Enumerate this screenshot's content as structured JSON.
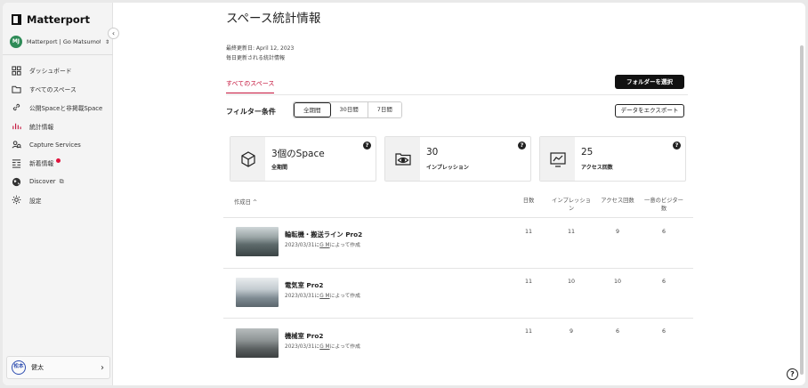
{
  "brand": {
    "name": "Matterport"
  },
  "org": {
    "initials": "MJ",
    "name": "Matterport | Go Matsumoto"
  },
  "sidebar": {
    "items": [
      {
        "label": "ダッシュボード",
        "icon": "dashboard-icon"
      },
      {
        "label": "すべてのスペース",
        "icon": "folder-icon"
      },
      {
        "label": "公開Spaceと非掲載Space",
        "icon": "link-icon"
      },
      {
        "label": "統計情報",
        "icon": "stats-icon",
        "active": true
      },
      {
        "label": "Capture Services",
        "icon": "capture-services-icon"
      },
      {
        "label": "新着情報",
        "icon": "news-icon",
        "badge": "red-dot"
      },
      {
        "label": "Discover",
        "icon": "globe-icon",
        "external": true
      },
      {
        "label": "設定",
        "icon": "gear-icon"
      }
    ]
  },
  "user": {
    "initials": "松本",
    "name": "健太"
  },
  "page": {
    "title": "スペース統計情報",
    "last_updated": "最終更新日: April 12, 2023",
    "update_note": "毎日更新される統計情報",
    "tab_all": "すべてのスペース",
    "select_folder": "フォルダーを選択",
    "filter_label": "フィルター条件",
    "filters": [
      "全期間",
      "30日間",
      "7日間"
    ],
    "active_filter": "全期間",
    "export": "データをエクスポート"
  },
  "cards": [
    {
      "value": "3個のSpace",
      "sub": "全期間",
      "icon": "cube-icon"
    },
    {
      "value": "30",
      "sub": "インプレッション",
      "icon": "eye-icon"
    },
    {
      "value": "25",
      "sub": "アクセス回数",
      "icon": "analytics-icon"
    }
  ],
  "table": {
    "headers": {
      "date": "作成日 ^",
      "days": "日数",
      "impressions": "インプレッション",
      "visits": "アクセス回数",
      "unique": "一意のビジター数"
    },
    "rows": [
      {
        "title": "輪転機・搬送ライン Pro2",
        "sub_prefix": "2023/03/31に",
        "author": "G M",
        "sub_suffix": "によって作成",
        "days": "11",
        "impressions": "11",
        "visits": "9",
        "unique": "6"
      },
      {
        "title": "電気室 Pro2",
        "sub_prefix": "2023/03/31に",
        "author": "G M",
        "sub_suffix": "によって作成",
        "days": "11",
        "impressions": "10",
        "visits": "10",
        "unique": "6"
      },
      {
        "title": "機械室 Pro2",
        "sub_prefix": "2023/03/31に",
        "author": "G M",
        "sub_suffix": "によって作成",
        "days": "11",
        "impressions": "9",
        "visits": "6",
        "unique": "6"
      }
    ]
  },
  "colors": {
    "accent": "#c4123a",
    "primary_button": "#111111",
    "badge": "#e0123c"
  }
}
